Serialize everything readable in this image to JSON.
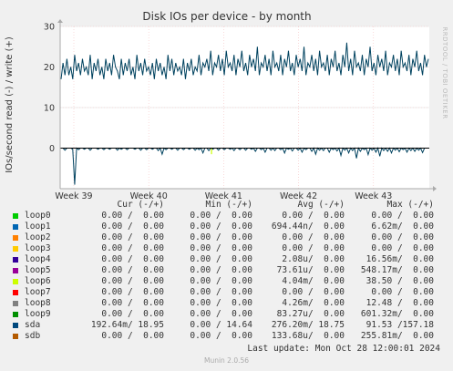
{
  "chart_data": {
    "type": "line",
    "title": "Disk IOs per device - by month",
    "ylabel": "IOs/second read (-) / write (+)",
    "side_label": "RRDTOOL / TOBI OETIKER",
    "ylim": [
      -10,
      30
    ],
    "yticks": [
      0,
      10,
      20,
      30
    ],
    "xticks": [
      "Week 39",
      "Week 40",
      "Week 41",
      "Week 42",
      "Week 43"
    ],
    "grid": true,
    "series": [
      {
        "name": "sda",
        "color": "#00425f",
        "write_values": [
          17,
          21,
          18,
          22,
          18,
          20,
          17,
          23,
          19,
          21,
          18,
          22,
          19,
          20,
          18,
          23,
          17,
          21,
          19,
          22,
          18,
          20,
          17,
          22,
          19,
          21,
          18,
          23,
          20,
          19,
          17,
          22,
          18,
          21,
          19,
          22,
          18,
          20,
          17,
          23,
          19,
          21,
          18,
          22,
          19,
          20,
          18,
          21,
          17,
          22,
          19,
          21,
          18,
          20,
          17,
          23,
          19,
          22,
          18,
          21,
          19,
          20,
          18,
          22,
          17,
          21,
          19,
          22,
          18,
          20,
          19,
          23,
          18,
          21,
          20,
          22,
          19,
          24,
          18,
          21,
          20,
          23,
          19,
          22,
          18,
          24,
          20,
          21,
          19,
          23,
          18,
          22,
          20,
          24,
          19,
          21,
          18,
          23,
          20,
          22,
          19,
          25,
          18,
          21,
          20,
          23,
          19,
          22,
          18,
          24,
          20,
          21,
          19,
          23,
          18,
          22,
          20,
          24,
          19,
          21,
          18,
          23,
          20,
          22,
          19,
          25,
          18,
          21,
          20,
          23,
          19,
          22,
          18,
          24,
          20,
          21,
          19,
          23,
          18,
          22,
          20,
          24,
          19,
          21,
          18,
          23,
          20,
          26,
          19,
          22,
          18,
          24,
          20,
          21,
          19,
          23,
          18,
          22,
          20,
          25,
          19,
          21,
          18,
          23,
          20,
          22,
          19,
          24,
          18,
          21,
          20,
          23,
          19,
          22,
          18,
          24,
          20,
          21,
          19,
          23,
          18,
          22,
          20,
          24,
          19,
          21,
          18,
          23,
          20,
          22
        ],
        "read_values": [
          0,
          0,
          -0.5,
          0,
          0,
          0,
          -0.3,
          -9,
          0,
          -0.4,
          0,
          0,
          -0.3,
          0,
          0,
          -0.5,
          0,
          0,
          0,
          -0.3,
          0,
          0,
          -0.4,
          0,
          0,
          -0.3,
          0,
          0,
          0,
          -0.5,
          0,
          -0.3,
          0,
          0,
          -0.4,
          0,
          0,
          0,
          -0.3,
          0,
          0,
          -0.5,
          0,
          0,
          -0.4,
          0,
          0,
          -0.3,
          0,
          0,
          -0.6,
          0,
          -1.5,
          0,
          -0.4,
          0,
          0,
          -0.3,
          0,
          0,
          -0.5,
          0,
          0,
          -0.4,
          0,
          0,
          -0.3,
          0,
          0,
          -0.5,
          0,
          -0.4,
          0,
          -1.2,
          0,
          0,
          -0.6,
          0,
          -0.3,
          0,
          0,
          -0.5,
          0,
          0,
          -0.4,
          0,
          0,
          -0.3,
          0,
          -0.6,
          0,
          0,
          -0.4,
          0,
          0,
          -0.5,
          0,
          0,
          -0.3,
          0,
          -0.8,
          0,
          0,
          -0.4,
          0,
          -1.0,
          0,
          0,
          -0.5,
          0,
          -0.6,
          0,
          0,
          -0.4,
          0,
          -1.2,
          0,
          -0.3,
          0,
          -0.7,
          0,
          0,
          -0.5,
          0,
          -1.0,
          0,
          -0.4,
          0,
          0,
          -0.8,
          0,
          -1.5,
          0,
          -0.5,
          0,
          -0.6,
          0,
          0,
          -1.0,
          0,
          -0.4,
          0,
          -0.7,
          0,
          -1.8,
          0,
          -0.5,
          0,
          -1.2,
          0,
          -0.6,
          0,
          -2.5,
          0,
          -0.8,
          0,
          -0.4,
          0,
          -1.6,
          0,
          -0.5,
          0,
          -1.0,
          0,
          -2.0,
          0,
          -0.6,
          0,
          -0.8,
          0,
          -1.2,
          0,
          -0.5,
          0,
          -0.9,
          0,
          -0.4,
          0,
          -1.0,
          0,
          -0.6,
          0,
          -0.8,
          0,
          -0.5,
          0,
          -1.1,
          0
        ]
      },
      {
        "name": "loop6",
        "color": "#ccff00",
        "spike": {
          "position": 0.41,
          "value": -1.5
        }
      }
    ]
  },
  "legend": {
    "headers": {
      "cur": "Cur (-/+)",
      "min": "Min (-/+)",
      "avg": "Avg (-/+)",
      "max": "Max (-/+)"
    },
    "rows": [
      {
        "name": "loop0",
        "color": "#00cc00",
        "cur": "0.00 /  0.00",
        "min": "0.00 /  0.00",
        "avg": "0.00 /  0.00",
        "max": "0.00 /  0.00"
      },
      {
        "name": "loop1",
        "color": "#0066b3",
        "cur": "0.00 /  0.00",
        "min": "0.00 /  0.00",
        "avg": "694.44n/  0.00",
        "max": "6.62m/  0.00"
      },
      {
        "name": "loop2",
        "color": "#ff8000",
        "cur": "0.00 /  0.00",
        "min": "0.00 /  0.00",
        "avg": "0.00 /  0.00",
        "max": "0.00 /  0.00"
      },
      {
        "name": "loop3",
        "color": "#ffcc00",
        "cur": "0.00 /  0.00",
        "min": "0.00 /  0.00",
        "avg": "0.00 /  0.00",
        "max": "0.00 /  0.00"
      },
      {
        "name": "loop4",
        "color": "#330099",
        "cur": "0.00 /  0.00",
        "min": "0.00 /  0.00",
        "avg": "2.08u/  0.00",
        "max": "16.56m/  0.00"
      },
      {
        "name": "loop5",
        "color": "#990099",
        "cur": "0.00 /  0.00",
        "min": "0.00 /  0.00",
        "avg": "73.61u/  0.00",
        "max": "548.17m/  0.00"
      },
      {
        "name": "loop6",
        "color": "#ccff00",
        "cur": "0.00 /  0.00",
        "min": "0.00 /  0.00",
        "avg": "4.04m/  0.00",
        "max": "38.50 /  0.00"
      },
      {
        "name": "loop7",
        "color": "#ff0000",
        "cur": "0.00 /  0.00",
        "min": "0.00 /  0.00",
        "avg": "0.00 /  0.00",
        "max": "0.00 /  0.00"
      },
      {
        "name": "loop8",
        "color": "#808080",
        "cur": "0.00 /  0.00",
        "min": "0.00 /  0.00",
        "avg": "4.26m/  0.00",
        "max": "12.48 /  0.00"
      },
      {
        "name": "loop9",
        "color": "#008f00",
        "cur": "0.00 /  0.00",
        "min": "0.00 /  0.00",
        "avg": "83.27u/  0.00",
        "max": "601.32m/  0.00"
      },
      {
        "name": "sda",
        "color": "#00487d",
        "cur": "192.64m/ 18.95",
        "min": "0.00 / 14.64",
        "avg": "276.20m/ 18.75",
        "max": "91.53 /157.18"
      },
      {
        "name": "sdb",
        "color": "#b35a00",
        "cur": "0.00 /  0.00",
        "min": "0.00 /  0.00",
        "avg": "133.68u/  0.00",
        "max": "255.81m/  0.00"
      }
    ],
    "last_update": "Last update: Mon Oct 28 12:00:01 2024"
  },
  "footer": {
    "munin": "Munin 2.0.56"
  }
}
